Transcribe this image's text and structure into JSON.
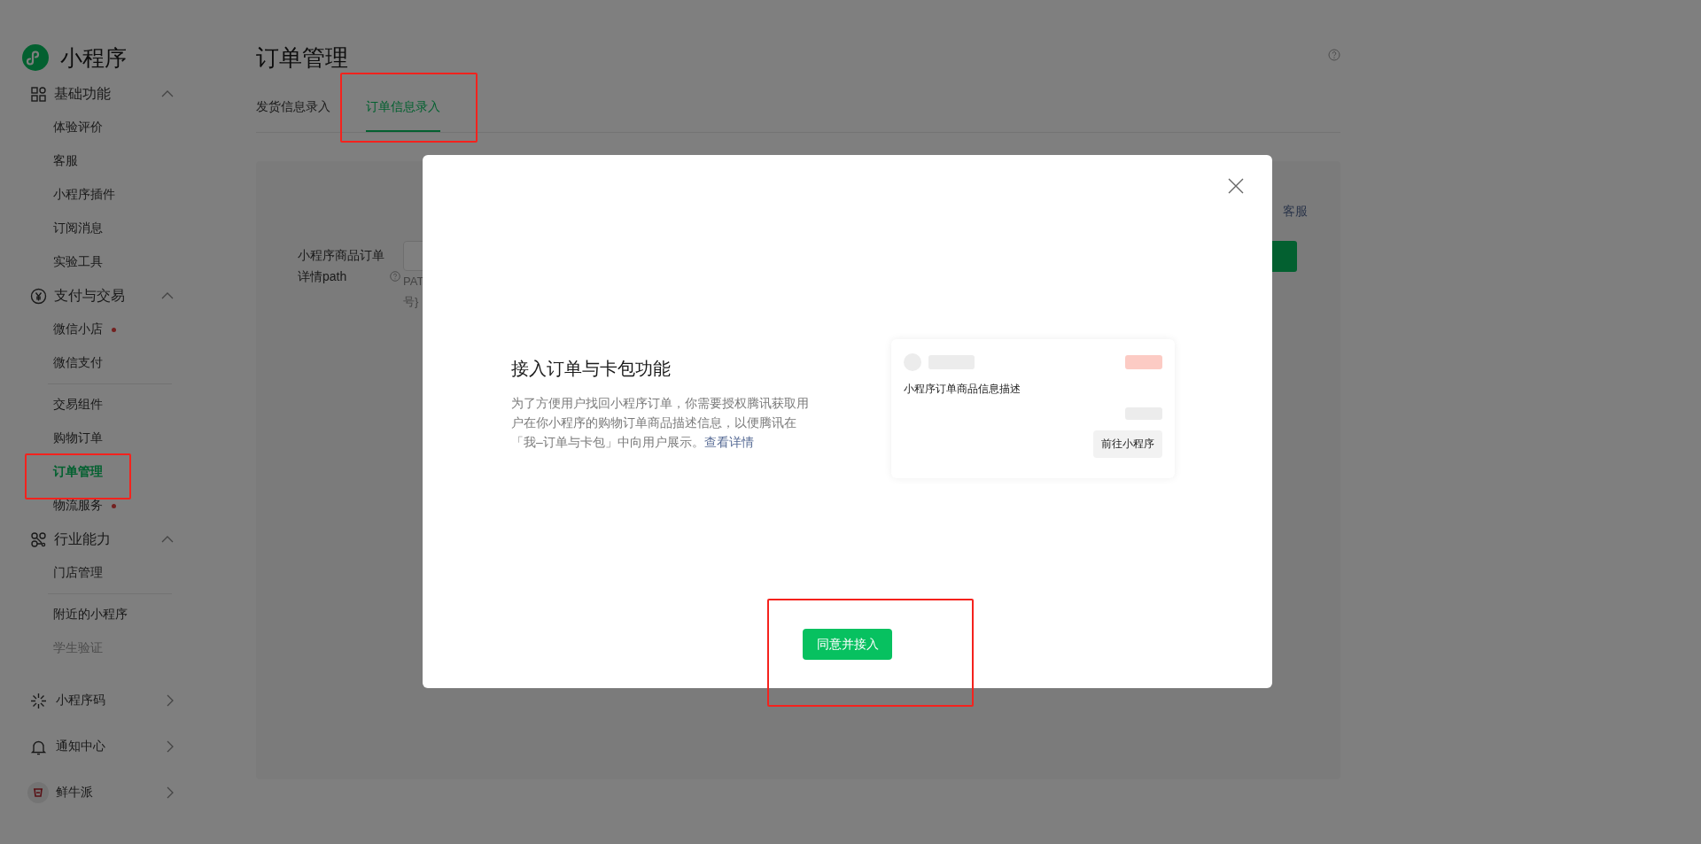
{
  "sidebar": {
    "brand": "小程序",
    "sections": [
      {
        "title": "基础功能",
        "expanded": true,
        "groups": [
          [
            {
              "label": "体验评价",
              "selected": false
            },
            {
              "label": "客服",
              "selected": false
            },
            {
              "label": "小程序插件",
              "selected": false
            },
            {
              "label": "订阅消息",
              "selected": false
            },
            {
              "label": "实验工具",
              "selected": false
            }
          ]
        ]
      },
      {
        "title": "支付与交易",
        "expanded": true,
        "groups": [
          [
            {
              "label": "微信小店",
              "selected": false,
              "dot": true
            },
            {
              "label": "微信支付",
              "selected": false
            }
          ],
          [
            {
              "label": "交易组件",
              "selected": false
            },
            {
              "label": "购物订单",
              "selected": false
            },
            {
              "label": "订单管理",
              "selected": true,
              "highlighted": true
            },
            {
              "label": "物流服务",
              "selected": false,
              "dot": true
            }
          ]
        ]
      },
      {
        "title": "行业能力",
        "expanded": true,
        "groups": [
          [
            {
              "label": "门店管理",
              "selected": false
            }
          ],
          [
            {
              "label": "附近的小程序",
              "selected": false
            },
            {
              "label": "学生验证",
              "selected": false,
              "dimmed": true
            }
          ]
        ]
      }
    ],
    "links": [
      {
        "label": "小程序码"
      },
      {
        "label": "通知中心"
      },
      {
        "label": "鲜牛派"
      }
    ]
  },
  "page": {
    "title": "订单管理",
    "tabs": [
      {
        "label": "发货信息录入",
        "selected": false
      },
      {
        "label": "订单信息录入",
        "selected": true,
        "highlighted": true
      }
    ],
    "form": {
      "service_link": "客服",
      "label": "小程序商品订单详情path",
      "hint_lines": [
        "PAT",
        "号}"
      ]
    }
  },
  "modal": {
    "title": "接入订单与卡包功能",
    "description": "为了方便用户找回小程序订单，你需要授权腾讯获取用户在你小程序的购物订单商品描述信息，以便腾讯在「我–订单与卡包」中向用户展示。",
    "link": "查看详情",
    "preview": {
      "description": "小程序订单商品信息描述",
      "button": "前往小程序"
    },
    "confirm": {
      "label": "同意并接入",
      "highlighted": true
    }
  }
}
